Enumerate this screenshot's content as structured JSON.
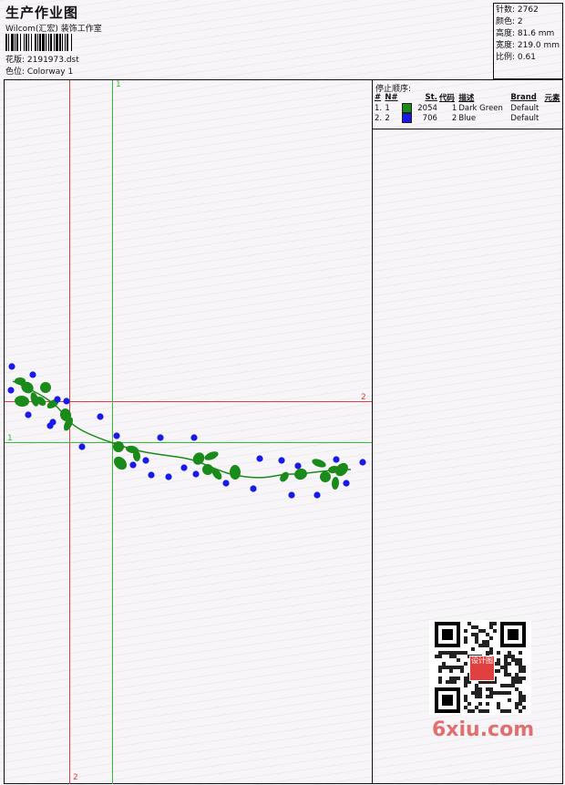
{
  "header": {
    "title": "生产作业图",
    "subtitle": "Wilcom(汇宏) 装饰工作室",
    "design_label": "花版: 2191973.dst",
    "colorway_label": "色位: Colorway 1"
  },
  "stats": {
    "stitches": "针数: 2762",
    "colors": "颜色: 2",
    "height": "高度: 81.6 mm",
    "width": "宽度: 219.0 mm",
    "scale": "比例: 0.61"
  },
  "stop_sequence": {
    "heading": "停止顺序:",
    "columns": [
      "#",
      "N#",
      "St.",
      "代码",
      "描述",
      "Brand",
      "元素"
    ],
    "rows": [
      {
        "idx": "1.",
        "n": "1",
        "stitches": "2054",
        "code": "1",
        "desc": "Dark Green",
        "brand": "Default",
        "color": "#1a8a1a"
      },
      {
        "idx": "2.",
        "n": "2",
        "stitches": "706",
        "code": "2",
        "desc": "Blue",
        "brand": "Default",
        "color": "#1a1ae6"
      }
    ]
  },
  "guides": {
    "red_v_top": "",
    "red_v_bottom": "2",
    "red_h_right": "2",
    "green_v_top": "1",
    "green_h_left": "1"
  },
  "watermark": {
    "text": "6xiu.com",
    "seal_text": "设计图"
  },
  "colors": {
    "guide_red": "#e04040",
    "guide_green": "#30c030",
    "thread_green": "#1a8a1a",
    "thread_blue": "#1a1ae6"
  }
}
